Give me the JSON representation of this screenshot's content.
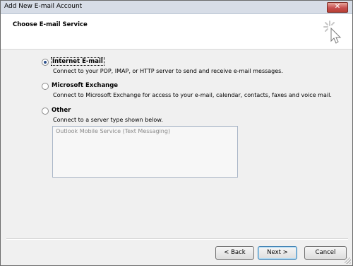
{
  "window": {
    "title": "Add New E-mail Account",
    "close_label": "✕"
  },
  "header": {
    "title": "Choose E-mail Service"
  },
  "options": [
    {
      "label": "Internet E-mail",
      "description": "Connect to your POP, IMAP, or HTTP server to send and receive e-mail messages.",
      "selected": true
    },
    {
      "label": "Microsoft Exchange",
      "description": "Connect to Microsoft Exchange for access to your e-mail, calendar, contacts, faxes and voice mail.",
      "selected": false
    },
    {
      "label": "Other",
      "description": "Connect to a server type shown below.",
      "selected": false
    }
  ],
  "other_services": [
    "Outlook Mobile Service (Text Messaging)"
  ],
  "buttons": {
    "back": "< Back",
    "next": "Next >",
    "cancel": "Cancel"
  },
  "colors": {
    "titlebar": "#d7dde7",
    "close_button": "#c75050",
    "radio_selected": "#2b4f8a"
  }
}
